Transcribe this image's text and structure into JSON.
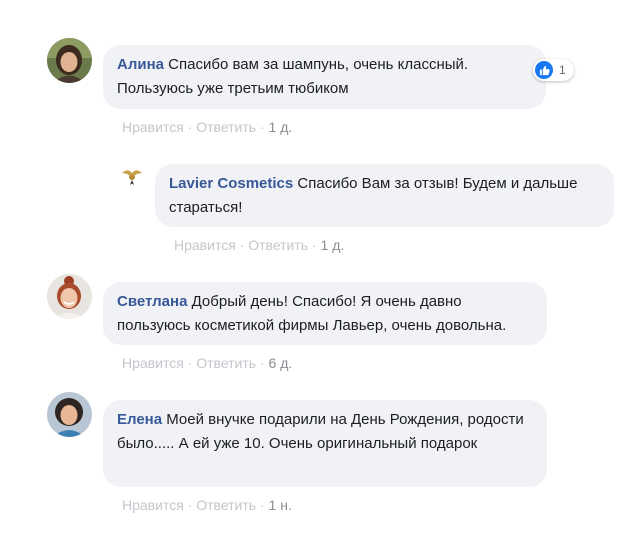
{
  "comments": [
    {
      "author": "Алина",
      "text": "Спасибо вам за шампунь, очень классный. Пользуюсь уже третьим тюбиком",
      "like_label": "Нравится",
      "reply_label": "Ответить",
      "time": "1 д.",
      "reaction_count": "1",
      "reaction_icon": "like-icon"
    },
    {
      "author": "Lavier Cosmetics",
      "text": "Спасибо Вам за отзыв! Будем и дальше стараться!",
      "like_label": "Нравится",
      "reply_label": "Ответить",
      "time": "1 д."
    },
    {
      "author": "Светлана",
      "text": "Добрый день! Спасибо! Я очень давно пользуюсь косметикой фирмы Лавьер, очень довольна.",
      "like_label": "Нравится",
      "reply_label": "Ответить",
      "time": "6 д."
    },
    {
      "author": "Елена",
      "text": "Моей внучке подарили на День Рождения, родости было..... А ей уже 10. Очень оригинальный подарок",
      "like_label": "Нравится",
      "reply_label": "Ответить",
      "time": "1 н."
    }
  ],
  "separator": "·",
  "colors": {
    "author": "#385898",
    "bubble_bg": "#f0f2f5",
    "action_text": "#c3c6cb",
    "like_blue": "#1877f2"
  }
}
